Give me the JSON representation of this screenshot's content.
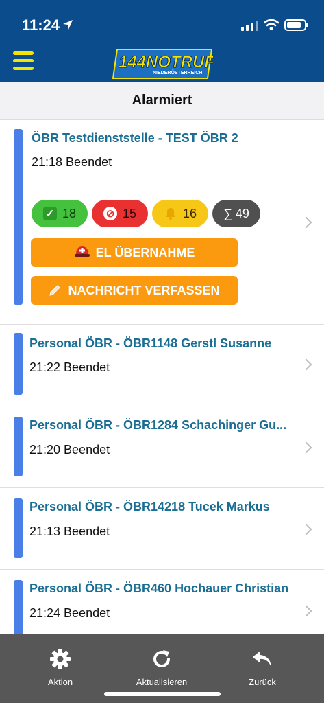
{
  "status_bar": {
    "time": "11:24"
  },
  "header": {
    "logo_text": "144NOTRUF",
    "logo_subtext": "NIEDERÖSTERREICH"
  },
  "page": {
    "title": "Alarmiert"
  },
  "first_item": {
    "title": "ÖBR Testdienststelle - TEST ÖBR 2",
    "status": "21:18 Beendet",
    "counts": {
      "accepted": "18",
      "declined": "15",
      "alerted": "16",
      "total": "∑ 49"
    },
    "buttons": {
      "el_takeover": "EL ÜBERNAHME",
      "compose_message": "NACHRICHT VERFASSEN"
    }
  },
  "items": [
    {
      "title": "Personal ÖBR - ÖBR1148 Gerstl Susanne",
      "status": "21:22 Beendet"
    },
    {
      "title": "Personal ÖBR - ÖBR1284 Schachinger Gu...",
      "status": "21:20 Beendet"
    },
    {
      "title": "Personal ÖBR - ÖBR14218 Tucek Markus",
      "status": "21:13 Beendet"
    },
    {
      "title": "Personal ÖBR - ÖBR460 Hochauer Christian",
      "status": "21:24 Beendet"
    }
  ],
  "bottom_nav": {
    "action": "Aktion",
    "refresh": "Aktualisieren",
    "back": "Zurück"
  },
  "colors": {
    "header_bg": "#0b4d8c",
    "accent_bar": "#4a7fe8",
    "title_text": "#1a6e94",
    "button_orange": "#fb9a0e",
    "menu_yellow": "#f4e400"
  }
}
